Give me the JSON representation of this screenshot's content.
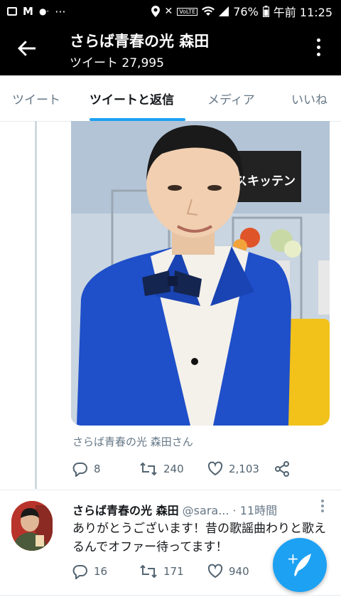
{
  "status_bar": {
    "volte": "VoLTE",
    "battery": "76%",
    "time": "午前 11:25",
    "overflow": "···"
  },
  "app_bar": {
    "title": "さらば青春の光 森田",
    "subtitle": "ツイート 27,995"
  },
  "tabs": [
    {
      "label": "ツイート",
      "active": false
    },
    {
      "label": "ツイートと返信",
      "active": true
    },
    {
      "label": "メディア",
      "active": false
    },
    {
      "label": "いいね",
      "active": false
    }
  ],
  "media_tweet": {
    "photo_text": "ミスキッテン",
    "caption": "さらば青春の光 森田さん",
    "replies": "8",
    "retweets": "240",
    "likes": "2,103"
  },
  "reply_tweet": {
    "name": "さらば青春の光 森田",
    "handle": "@sara...",
    "time": "· 11時間",
    "text": "ありがとうございます！昔の歌謡曲わりと歌えるんでオファー待ってます！",
    "replies": "16",
    "retweets": "171",
    "likes": "940"
  },
  "colors": {
    "accent": "#1da1f2",
    "jacket": "#1f4fc9",
    "muted": "#657786"
  }
}
